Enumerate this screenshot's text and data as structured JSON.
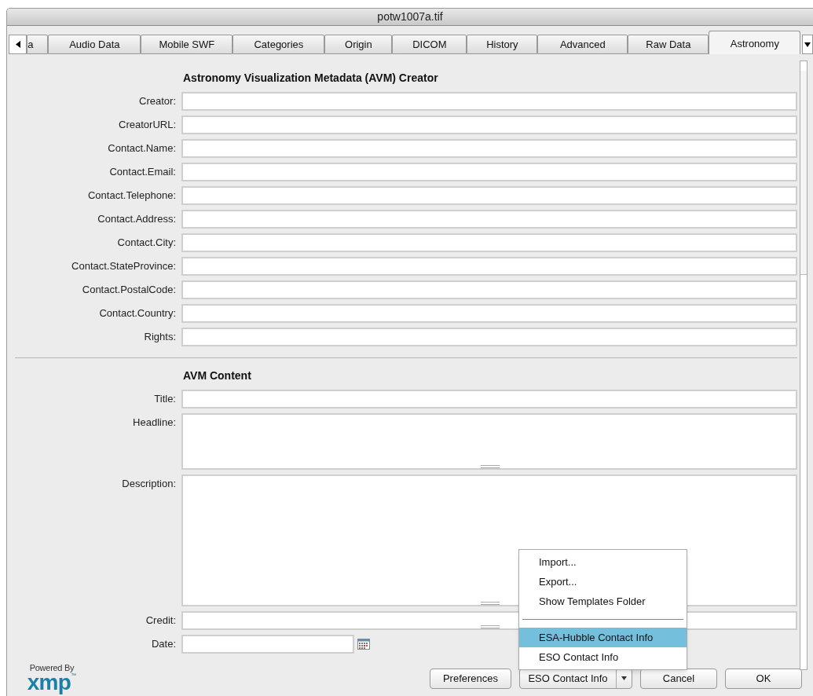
{
  "window": {
    "title": "potw1007a.tif"
  },
  "tabs": [
    {
      "label": "a",
      "selected": false
    },
    {
      "label": "Audio Data",
      "selected": false
    },
    {
      "label": "Mobile SWF",
      "selected": false
    },
    {
      "label": "Categories",
      "selected": false
    },
    {
      "label": "Origin",
      "selected": false
    },
    {
      "label": "DICOM",
      "selected": false
    },
    {
      "label": "History",
      "selected": false
    },
    {
      "label": "Advanced",
      "selected": false
    },
    {
      "label": "Raw Data",
      "selected": false
    },
    {
      "label": "Astronomy",
      "selected": true
    }
  ],
  "sections": [
    {
      "heading": "Astronomy Visualization Metadata (AVM) Creator",
      "fields": [
        {
          "label": "Creator:",
          "kind": "line"
        },
        {
          "label": "CreatorURL:",
          "kind": "line"
        },
        {
          "label": "Contact.Name:",
          "kind": "line"
        },
        {
          "label": "Contact.Email:",
          "kind": "line"
        },
        {
          "label": "Contact.Telephone:",
          "kind": "line"
        },
        {
          "label": "Contact.Address:",
          "kind": "line"
        },
        {
          "label": "Contact.City:",
          "kind": "line"
        },
        {
          "label": "Contact.StateProvince:",
          "kind": "line"
        },
        {
          "label": "Contact.PostalCode:",
          "kind": "line"
        },
        {
          "label": "Contact.Country:",
          "kind": "line"
        },
        {
          "label": "Rights:",
          "kind": "line"
        }
      ]
    },
    {
      "heading": "AVM Content",
      "fields": [
        {
          "label": "Title:",
          "kind": "line"
        },
        {
          "label": "Headline:",
          "kind": "area"
        },
        {
          "label": "Description:",
          "kind": "tall"
        },
        {
          "label": "Credit:",
          "kind": "short"
        },
        {
          "label": "Date:",
          "kind": "date"
        }
      ]
    }
  ],
  "footer": {
    "logo_caption": "Powered By",
    "logo_word": "xmp",
    "logo_mark": "™",
    "buttons": [
      {
        "label": "Preferences",
        "kind": "plain"
      },
      {
        "label": "ESO Contact Info",
        "kind": "split"
      },
      {
        "label": "Cancel",
        "kind": "plain"
      },
      {
        "label": "OK",
        "kind": "plain"
      }
    ]
  },
  "menu": [
    {
      "label": "Import...",
      "kind": "item",
      "selected": false
    },
    {
      "label": "Export...",
      "kind": "item",
      "selected": false
    },
    {
      "label": "Show Templates Folder",
      "kind": "item",
      "selected": false
    },
    {
      "kind": "separator"
    },
    {
      "label": "ESA-Hubble Contact Info",
      "kind": "item",
      "selected": true
    },
    {
      "label": "ESO Contact Info",
      "kind": "item",
      "selected": false
    }
  ]
}
